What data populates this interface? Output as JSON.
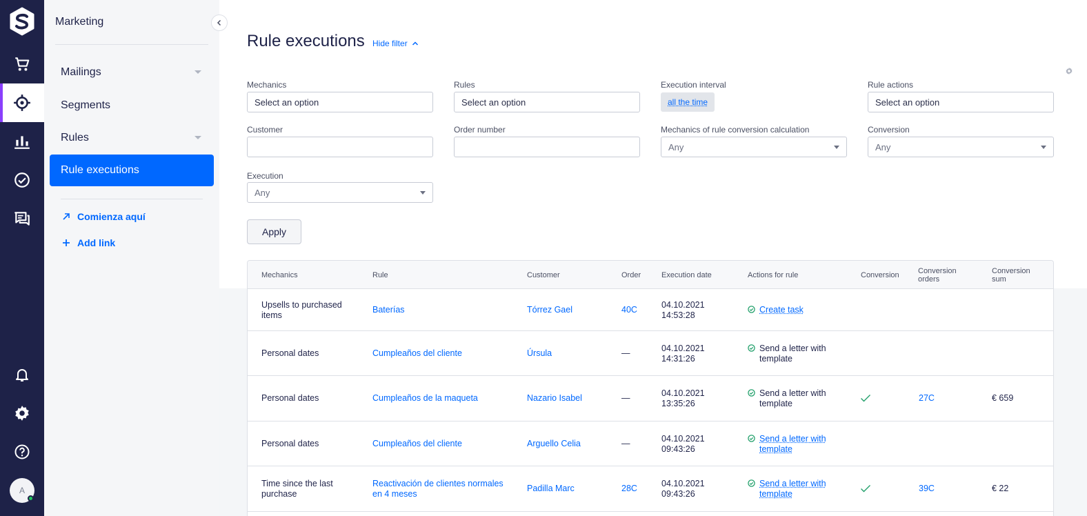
{
  "sidebar": {
    "section_title": "Marketing",
    "items": [
      {
        "label": "Mailings",
        "has_caret": true
      },
      {
        "label": "Segments",
        "has_caret": false
      },
      {
        "label": "Rules",
        "has_caret": true
      },
      {
        "label": "Rule executions",
        "active": true
      }
    ],
    "links": [
      {
        "label": "Comienza aquí",
        "icon": "arrow-up-right-icon"
      },
      {
        "label": "Add link",
        "icon": "plus-icon"
      }
    ]
  },
  "rail": {
    "icons": [
      "logo-icon",
      "cart-icon",
      "target-icon",
      "analytics-icon",
      "tasks-icon",
      "chat-icon",
      "bell-icon",
      "settings-icon",
      "help-icon"
    ],
    "active": "target-icon",
    "avatar_initial": "A"
  },
  "page": {
    "title": "Rule executions",
    "hide_filter": "Hide filter"
  },
  "filters": {
    "mechanics": {
      "label": "Mechanics",
      "placeholder": "Select an option"
    },
    "rules": {
      "label": "Rules",
      "placeholder": "Select an option"
    },
    "execution_interval": {
      "label": "Execution interval",
      "value": "all the time"
    },
    "rule_actions": {
      "label": "Rule actions",
      "placeholder": "Select an option"
    },
    "customer": {
      "label": "Customer",
      "value": ""
    },
    "order_number": {
      "label": "Order number",
      "value": ""
    },
    "mechanics_conversion": {
      "label": "Mechanics of rule conversion calculation",
      "value": "Any"
    },
    "conversion": {
      "label": "Conversion",
      "value": "Any"
    },
    "execution": {
      "label": "Execution",
      "value": "Any"
    },
    "apply_label": "Apply"
  },
  "table": {
    "headers": {
      "mechanics": "Mechanics",
      "rule": "Rule",
      "customer": "Customer",
      "order": "Order",
      "execution_date": "Execution date",
      "actions": "Actions for rule",
      "conversion": "Conversion",
      "conversion_orders_1": "Conversion",
      "conversion_orders_2": "orders",
      "conversion_sum_1": "Conversion",
      "conversion_sum_2": "sum"
    },
    "rows": [
      {
        "mechanics_1": "Upsells to purchased",
        "mechanics_2": "items",
        "rule_1": "Baterías",
        "rule_2": "",
        "customer": "Tórrez Gael",
        "order": "40C",
        "date": "04.10.2021",
        "time": "14:53:28",
        "action_1": "Create task",
        "action_2": "",
        "action_link": true,
        "conversion": false,
        "conv_orders": "",
        "conv_sum": ""
      },
      {
        "mechanics_1": "Personal dates",
        "mechanics_2": "",
        "rule_1": "Cumpleaños del cliente",
        "rule_2": "",
        "customer": "Úrsula",
        "order": "—",
        "date": "04.10.2021",
        "time": "14:31:26",
        "action_1": "Send a letter with",
        "action_2": "template",
        "action_link": false,
        "conversion": false,
        "conv_orders": "",
        "conv_sum": ""
      },
      {
        "mechanics_1": "Personal dates",
        "mechanics_2": "",
        "rule_1": "Cumpleaños de la maqueta",
        "rule_2": "",
        "customer": "Nazario Isabel",
        "order": "—",
        "date": "04.10.2021",
        "time": "13:35:26",
        "action_1": "Send a letter with",
        "action_2": "template",
        "action_link": false,
        "conversion": true,
        "conv_orders": "27C",
        "conv_sum": "€ 659"
      },
      {
        "mechanics_1": "Personal dates",
        "mechanics_2": "",
        "rule_1": "Cumpleaños del cliente",
        "rule_2": "",
        "customer": "Arguello Celia",
        "order": "—",
        "date": "04.10.2021",
        "time": "09:43:26",
        "action_1": "Send a letter with",
        "action_2": "template",
        "action_link": true,
        "conversion": false,
        "conv_orders": "",
        "conv_sum": ""
      },
      {
        "mechanics_1": "Time since the last",
        "mechanics_2": "purchase",
        "rule_1": "Reactivación de clientes normales",
        "rule_2": "en 4 meses",
        "customer": "Padilla Marc",
        "order": "28C",
        "date": "04.10.2021",
        "time": "09:43:26",
        "action_1": "Send a letter with",
        "action_2": "template",
        "action_link": true,
        "conversion": true,
        "conv_orders": "39C",
        "conv_sum": "€ 22"
      }
    ]
  },
  "colors": {
    "rail": "#1e2248",
    "accent": "#0068ff",
    "active_marker": "#8a3ffc",
    "success": "#22a06b"
  }
}
